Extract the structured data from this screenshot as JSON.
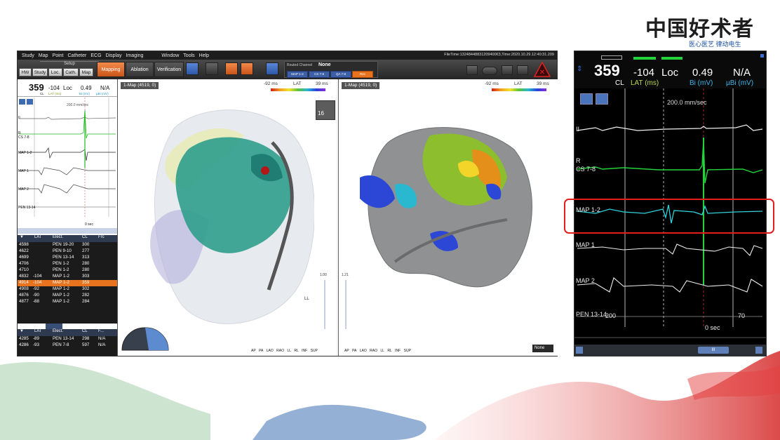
{
  "logo": {
    "text": "中国好术者",
    "subtitle": "医心医艺  律动电生"
  },
  "menu": [
    "Study",
    "Map",
    "Point",
    "Catheter",
    "ECG",
    "Display",
    "Imaging",
    "Window",
    "Tools",
    "Help"
  ],
  "file_time": "FileTime:13248448831209400€3,Time:2020.10.29.12:40:31.209",
  "toolbar": {
    "setup": "Setup",
    "tabs": [
      "HW",
      "Study",
      "Loc.",
      "Cath.",
      "Map"
    ],
    "modes": {
      "mapping": "Mapping",
      "ablation": "Ablation",
      "verification": "Verification"
    },
    "routed_label": "Routed Channel",
    "routed_value": "None",
    "chips": [
      "MAP 1-2",
      "CS 7-8",
      "QA 7-8",
      "Rec"
    ]
  },
  "left_panel": {
    "cl": "359",
    "lat": "-104",
    "loc": "Loc",
    "bi": "0.49",
    "ubi": "N/A",
    "cl_unit": "CL",
    "lat_unit": "LAT (ms)",
    "bi_unit": "Bi (mV)",
    "ubi_unit": "µBi (mV)",
    "speed": "200.0 mm/sec",
    "channels": [
      "II",
      "R\nCS 7-8",
      "MAP 1-2",
      "MAP 1",
      "MAP 2",
      "PEN 13-14"
    ],
    "sec": "0 sec"
  },
  "point_table": {
    "headers": [
      "LAT",
      "Elect.",
      "CL",
      "Frc"
    ],
    "rows": [
      {
        "id": "4598",
        "lat": "",
        "elect": "PEN 19-20",
        "cl": "300",
        "sel": false
      },
      {
        "id": "4622",
        "lat": "",
        "elect": "PEN 9-10",
        "cl": "277",
        "sel": false
      },
      {
        "id": "4699",
        "lat": "",
        "elect": "PEN 13-14",
        "cl": "313",
        "sel": false
      },
      {
        "id": "4706",
        "lat": "",
        "elect": "PEN 1-2",
        "cl": "280",
        "sel": false
      },
      {
        "id": "4710",
        "lat": "",
        "elect": "PEN 1-2",
        "cl": "280",
        "sel": false
      },
      {
        "id": "4832",
        "lat": "-104",
        "elect": "MAP 1-2",
        "cl": "303",
        "sel": false
      },
      {
        "id": "4914",
        "lat": "-104",
        "elect": "MAP 1-2",
        "cl": "359",
        "sel": true
      },
      {
        "id": "4908",
        "lat": "-92",
        "elect": "MAP 1-2",
        "cl": "302",
        "sel": false
      },
      {
        "id": "4876",
        "lat": "-90",
        "elect": "MAP 1-2",
        "cl": "282",
        "sel": false
      },
      {
        "id": "4877",
        "lat": "-88",
        "elect": "MAP 1-2",
        "cl": "284",
        "sel": false
      }
    ],
    "headers2": [
      "LAT",
      "Elect.",
      "CL",
      "F..."
    ],
    "rows2": [
      {
        "id": "4285",
        "lat": "-89",
        "elect": "PEN 13-14",
        "cl": "298",
        "f": "N/A"
      },
      {
        "id": "4286",
        "lat": "-93",
        "elect": "PEN 7-8",
        "cl": "597",
        "f": "N/A"
      }
    ]
  },
  "map_left": {
    "title": "1-Map (4519, 0)",
    "lat_min": "-92 ms",
    "lat_label": "LAT",
    "lat_max": "39 ms",
    "counter": "16",
    "scale_top": "1.00",
    "view_label": "LL",
    "views": [
      "AP",
      "PA",
      "LAO",
      "RAO",
      "LL",
      "RL",
      "INF",
      "SUP"
    ]
  },
  "map_right": {
    "title": "1-Map (4519, 0)",
    "lat_min": "-92 ms",
    "lat_label": "LAT",
    "lat_max": "39 ms",
    "scale_top": "1.21",
    "views": [
      "AP",
      "PA",
      "LAO",
      "RAO",
      "LL",
      "RL",
      "INF",
      "SUP"
    ],
    "none_select": "None"
  },
  "zoom_panel": {
    "cl": "359",
    "lat": "-104",
    "loc": "Loc",
    "bi": "0.49",
    "ubi": "N/A",
    "cl_unit": "CL",
    "lat_unit": "LAT (ms)",
    "bi_unit": "Bi (mV)",
    "ubi_unit": "µBi (mV)",
    "speed": "200.0 mm/sec",
    "ch_ii": "II",
    "ch_r": "R",
    "ch_cs": "CS 7-8",
    "ch_map12": "MAP 1-2",
    "ch_map1": "MAP 1",
    "ch_map2": "MAP 2",
    "ch_pen": "PEN 13-14",
    "v200": "200",
    "v70": "70",
    "sec": "0 sec",
    "scroll": "III"
  },
  "colors": {
    "accent_orange": "#e8731e",
    "ecg_green": "#22d33a",
    "ecg_cyan": "#2fd3dc",
    "highlight_red": "#e21d1d"
  }
}
